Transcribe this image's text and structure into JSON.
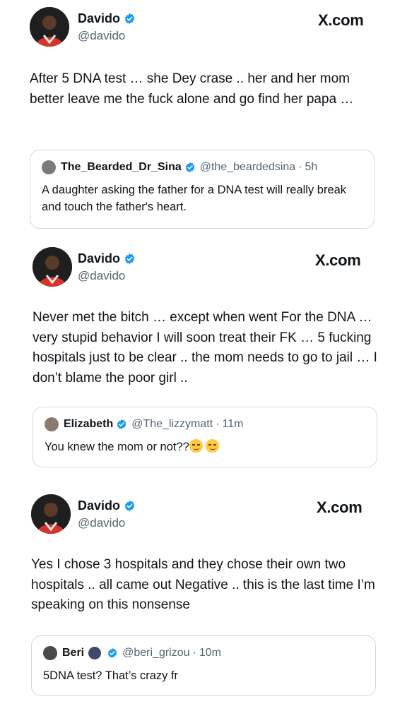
{
  "colors": {
    "verified": "#1d9bf0",
    "text": "#0f1419",
    "secondary": "#536471",
    "border": "#cfd9de"
  },
  "posts": [
    {
      "name": "Davido",
      "handle": "@davido",
      "brand": "X.com",
      "text": "After 5 DNA test … she Dey crase .. her and her mom better leave me the fuck alone  and go find her papa …",
      "quote": {
        "name": "The_Bearded_Dr_Sina",
        "handle": "@the_beardedsina",
        "sep": "·",
        "time": "5h",
        "text": "A daughter asking the father for a DNA test will really break and touch the father's heart."
      }
    },
    {
      "name": "Davido",
      "handle": "@davido",
      "brand": "X.com",
      "text": "Never met the bitch … except when went For the DNA … very stupid behavior I will soon treat their FK … 5 fucking hospitals just to be clear .. the mom needs to go to jail … I don’t blame the poor girl ..",
      "quote": {
        "name": "Elizabeth",
        "handle": "@The_lizzymatt",
        "sep": "·",
        "time": "11m",
        "text": "You knew the mom or not??",
        "emojis": [
          "smirking-face",
          "smirking-face"
        ]
      }
    },
    {
      "name": "Davido",
      "handle": "@davido",
      "brand": "X.com",
      "text": "Yes I chose 3 hospitals and they chose their own two hospitals .. all came out Negative .. this is the last time I’m speaking on this nonsense",
      "quote": {
        "name": "Beri",
        "handle": "@beri_grizou",
        "sep": "·",
        "time": "10m",
        "text": "5DNA test? That’s crazy fr",
        "name_emoji": "dark-face"
      }
    }
  ]
}
